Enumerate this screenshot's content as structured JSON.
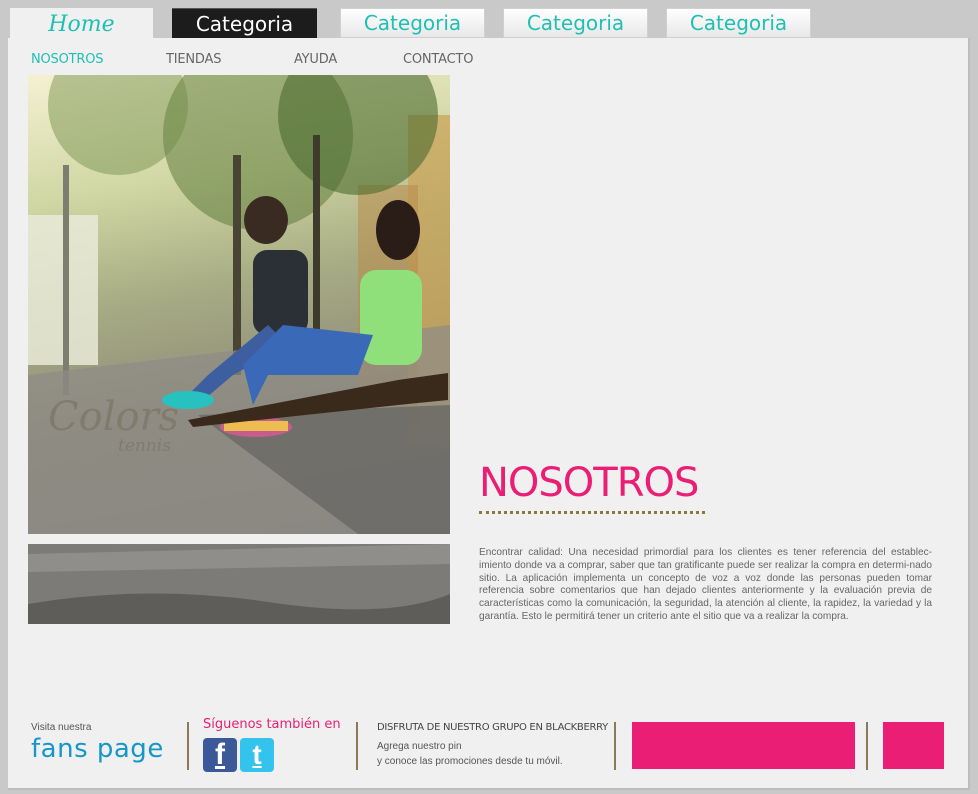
{
  "tabs": [
    {
      "label": "Home"
    },
    {
      "label": "Categoria"
    },
    {
      "label": "Categoria"
    },
    {
      "label": "Categoria"
    },
    {
      "label": "Categoria"
    }
  ],
  "subnav": [
    {
      "label": "NOSOTROS"
    },
    {
      "label": "TIENDAS"
    },
    {
      "label": "AYUDA"
    },
    {
      "label": "CONTACTO"
    }
  ],
  "photo": {
    "watermark_line1": "Colors",
    "watermark_line2": "tennis"
  },
  "section": {
    "title": "NOSOTROS",
    "body": "Encontrar calidad: Una necesidad primordial para los clientes es tener referencia del establec-imiento donde va a comprar, saber que tan gratificante puede ser realizar la compra en determi-nado sitio. La aplicación implementa un concepto de voz a voz donde las personas pueden tomar referencia sobre comentarios que han dejado clientes anteriormente y la evaluación previa de características como la comunicación, la seguridad, la atención al cliente, la rapidez, la variedad y la garantía. Esto le permitirá tener un criterio ante el sitio que va a realizar la compra."
  },
  "footer": {
    "visit_label": "Visita nuestra",
    "fans_label": "fans page",
    "follow_label": "Síguenos también en",
    "facebook_glyph": "f",
    "twitter_glyph": "t",
    "bb_title": "DISFRUTA DE NUESTRO GRUPO EN BLACKBERRY",
    "bb_line1": "Agrega nuestro pin",
    "bb_line2": "y conoce las promociones desde tu móvil."
  },
  "colors": {
    "accent_teal": "#1fc0b4",
    "accent_pink": "#ea1e74"
  }
}
